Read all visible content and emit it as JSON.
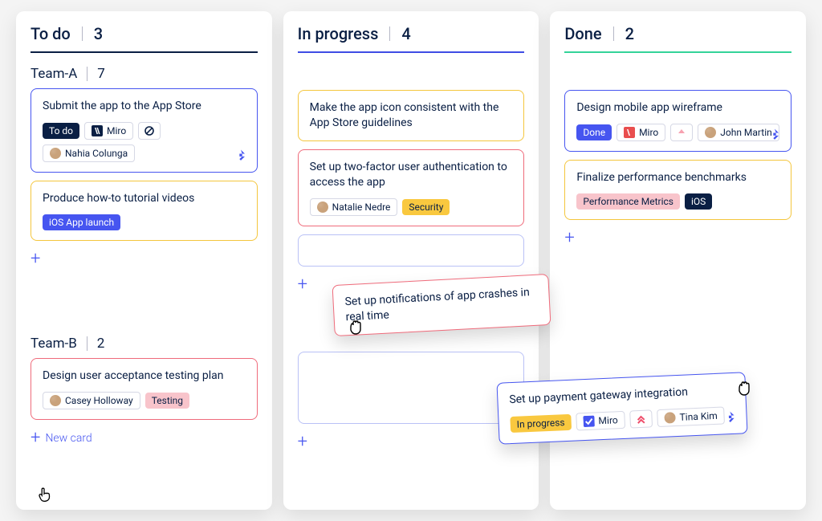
{
  "columns": [
    {
      "title": "To do",
      "count": "3",
      "divider": "todo"
    },
    {
      "title": "In progress",
      "count": "4",
      "divider": "inprog"
    },
    {
      "title": "Done",
      "count": "2",
      "divider": "done"
    }
  ],
  "swimlanes": {
    "teamA": {
      "name": "Team-A",
      "count": "7"
    },
    "teamB": {
      "name": "Team-B",
      "count": "2"
    }
  },
  "cards": {
    "appstore": {
      "title": "Submit the app to the App Store",
      "status_label": "To do",
      "integration": "Miro",
      "assignee": "Nahia Colunga"
    },
    "tutorial": {
      "title": "Produce how-to tutorial videos",
      "tag": "iOS App launch"
    },
    "uat": {
      "title": "Design user acceptance testing plan",
      "assignee": "Casey Holloway",
      "tag": "Testing"
    },
    "icon": {
      "title": "Make the app icon consistent with the App Store guidelines"
    },
    "twofa": {
      "title": "Set up two-factor user authentication to access the app",
      "assignee": "Natalie Nedre",
      "tag": "Security"
    },
    "crashnotif": {
      "title": "Set up notifications of app crashes in real time"
    },
    "wireframe": {
      "title": "Design mobile app wireframe",
      "status_label": "Done",
      "integration": "Miro",
      "assignee": "John Martin"
    },
    "benchmarks": {
      "title": "Finalize performance benchmarks",
      "tag1": "Performance Metrics",
      "tag2": "iOS"
    },
    "payment": {
      "title": "Set up payment gateway integration",
      "status_label": "In progress",
      "integration": "Miro",
      "assignee": "Tina Kim"
    }
  },
  "actions": {
    "new_card_label": "New card"
  }
}
